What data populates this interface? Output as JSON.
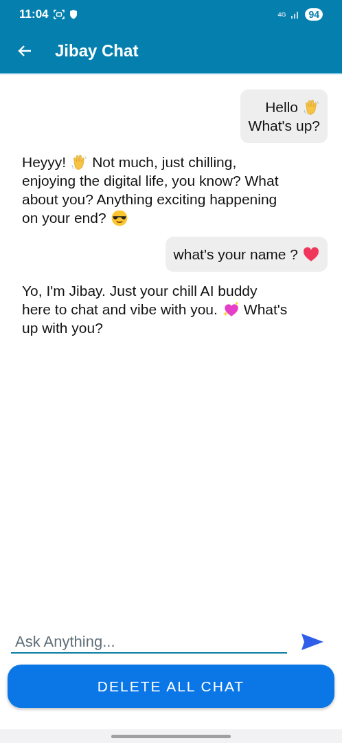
{
  "status_bar": {
    "time": "11:04",
    "network": "4G",
    "battery": "94"
  },
  "app_bar": {
    "title": "Jibay Chat"
  },
  "messages": [
    {
      "kind": "sent",
      "lines": [
        [
          {
            "kind": "text",
            "text": "Hello"
          },
          {
            "kind": "wave"
          }
        ],
        [
          {
            "kind": "text",
            "text": "What's up?"
          }
        ]
      ]
    },
    {
      "kind": "received",
      "lines": [
        [
          {
            "kind": "text",
            "text": "Heyyy!"
          },
          {
            "kind": "wave"
          },
          {
            "kind": "text",
            "text": "Not much, just chilling,"
          }
        ],
        [
          {
            "kind": "text",
            "text": "enjoying the digital life, you know? What"
          }
        ],
        [
          {
            "kind": "text",
            "text": "about you? Anything exciting happening"
          }
        ],
        [
          {
            "kind": "text",
            "text": "on your end?"
          },
          {
            "kind": "sunglasses"
          }
        ]
      ]
    },
    {
      "kind": "sent",
      "lines": [
        [
          {
            "kind": "text",
            "text": "what's your name ?"
          },
          {
            "kind": "heart"
          }
        ]
      ]
    },
    {
      "kind": "received",
      "lines": [
        [
          {
            "kind": "text",
            "text": "Yo, I'm Jibay. Just your chill AI buddy"
          }
        ],
        [
          {
            "kind": "text",
            "text": "here to chat and vibe with you."
          },
          {
            "kind": "sparkle-heart"
          },
          {
            "kind": "text",
            "text": "What's"
          }
        ],
        [
          {
            "kind": "text",
            "text": "up with you?"
          }
        ]
      ]
    }
  ],
  "input": {
    "placeholder": "Ask Anything..."
  },
  "delete_button": {
    "label": "DELETE ALL CHAT"
  }
}
